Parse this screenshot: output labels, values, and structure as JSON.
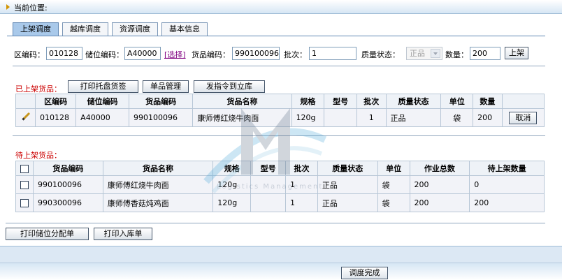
{
  "header": {
    "location_label": "当前位置:"
  },
  "tabs": [
    {
      "label": "上架调度",
      "active": true
    },
    {
      "label": "越库调度",
      "active": false
    },
    {
      "label": "资源调度",
      "active": false
    },
    {
      "label": "基本信息",
      "active": false
    }
  ],
  "form": {
    "zone_label": "区编码：",
    "zone_value": "010128",
    "slot_label": "储位编码：",
    "slot_value": "A40000",
    "select_link": "[选择]",
    "goods_label": "货品编码：",
    "goods_value": "990100096",
    "batch_label": "批次：",
    "batch_value": "1",
    "quality_label": "质量状态：",
    "quality_value": "正品",
    "qty_label": "数量：",
    "qty_value": "200",
    "shelve_button": "上架"
  },
  "shelved": {
    "title": "已上架货品：",
    "buttons": [
      "打印托盘货签",
      "单品管理",
      "发指令到立库"
    ],
    "columns": [
      "",
      "区编码",
      "储位编码",
      "货品编码",
      "货品名称",
      "规格",
      "型号",
      "批次",
      "质量状态",
      "单位",
      "数量",
      ""
    ],
    "rows": [
      {
        "zone": "010128",
        "slot": "A40000",
        "goods_code": "990100096",
        "goods_name": "康师傅红烧牛肉面",
        "spec": "120g",
        "model": "",
        "batch": "1",
        "quality": "正品",
        "unit": "袋",
        "qty": "200",
        "action": "取消"
      }
    ]
  },
  "pending": {
    "title": "待上架货品：",
    "columns": [
      "",
      "货品编码",
      "货品名称",
      "规格",
      "型号",
      "批次",
      "质量状态",
      "单位",
      "作业总数",
      "待上架数量"
    ],
    "rows": [
      {
        "goods_code": "990100096",
        "goods_name": "康师傅红烧牛肉面",
        "spec": "120g",
        "model": "",
        "batch": "1",
        "quality": "正品",
        "unit": "袋",
        "total": "200",
        "pending_qty": "0"
      },
      {
        "goods_code": "990300096",
        "goods_name": "康师傅香菇炖鸡面",
        "spec": "120g",
        "model": "",
        "batch": "1",
        "quality": "正品",
        "unit": "袋",
        "total": "200",
        "pending_qty": "200"
      }
    ]
  },
  "bottom_buttons": [
    "打印储位分配单",
    "打印入库单"
  ],
  "finish_button": "调度完成",
  "watermark": {
    "letter": "M",
    "text": "Logistics Management"
  },
  "colors": {
    "accent": "#a9c9ea",
    "title_red": "#cc0000",
    "link": "#800080"
  }
}
